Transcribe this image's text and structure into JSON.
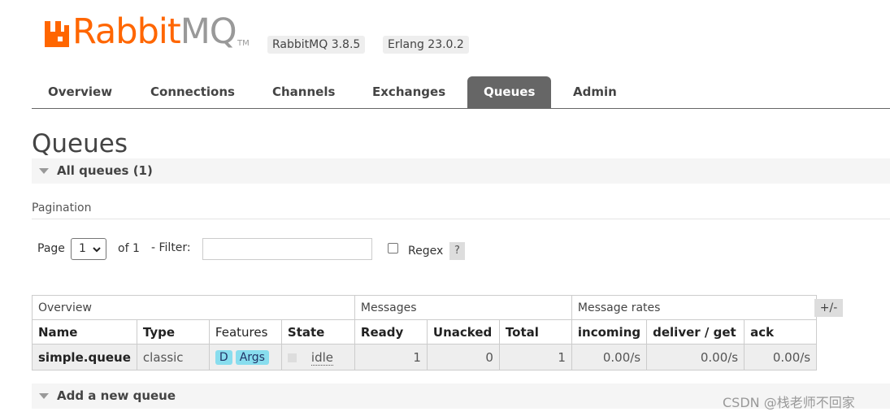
{
  "header": {
    "logo_text_rabbit": "Rabbit",
    "logo_text_mq": "MQ",
    "trademark": "TM",
    "version_badge": "RabbitMQ 3.8.5",
    "erlang_badge": "Erlang 23.0.2",
    "brand_color": "#ff6600"
  },
  "nav": {
    "tabs": [
      {
        "label": "Overview"
      },
      {
        "label": "Connections"
      },
      {
        "label": "Channels"
      },
      {
        "label": "Exchanges"
      },
      {
        "label": "Queues",
        "active": true
      },
      {
        "label": "Admin"
      }
    ]
  },
  "page": {
    "title": "Queues",
    "all_queues_label": "All queues (1)",
    "add_queue_label": "Add a new queue"
  },
  "pagination": {
    "section_label": "Pagination",
    "page_label": "Page",
    "page_value": "1",
    "of_label": "of 1",
    "filter_label": "- Filter:",
    "filter_value": "",
    "regex_label": "Regex",
    "regex_checked": false,
    "help_label": "?"
  },
  "table": {
    "groups": [
      "Overview",
      "Messages",
      "Message rates"
    ],
    "columns": [
      "Name",
      "Type",
      "Features",
      "State",
      "Ready",
      "Unacked",
      "Total",
      "incoming",
      "deliver / get",
      "ack"
    ],
    "toggle_label": "+/-",
    "rows": [
      {
        "name": "simple.queue",
        "type": "classic",
        "features": [
          "D",
          "Args"
        ],
        "state": "idle",
        "ready": "1",
        "unacked": "0",
        "total": "1",
        "incoming": "0.00/s",
        "deliver_get": "0.00/s",
        "ack": "0.00/s"
      }
    ]
  },
  "watermark": "CSDN @栈老师不回家"
}
